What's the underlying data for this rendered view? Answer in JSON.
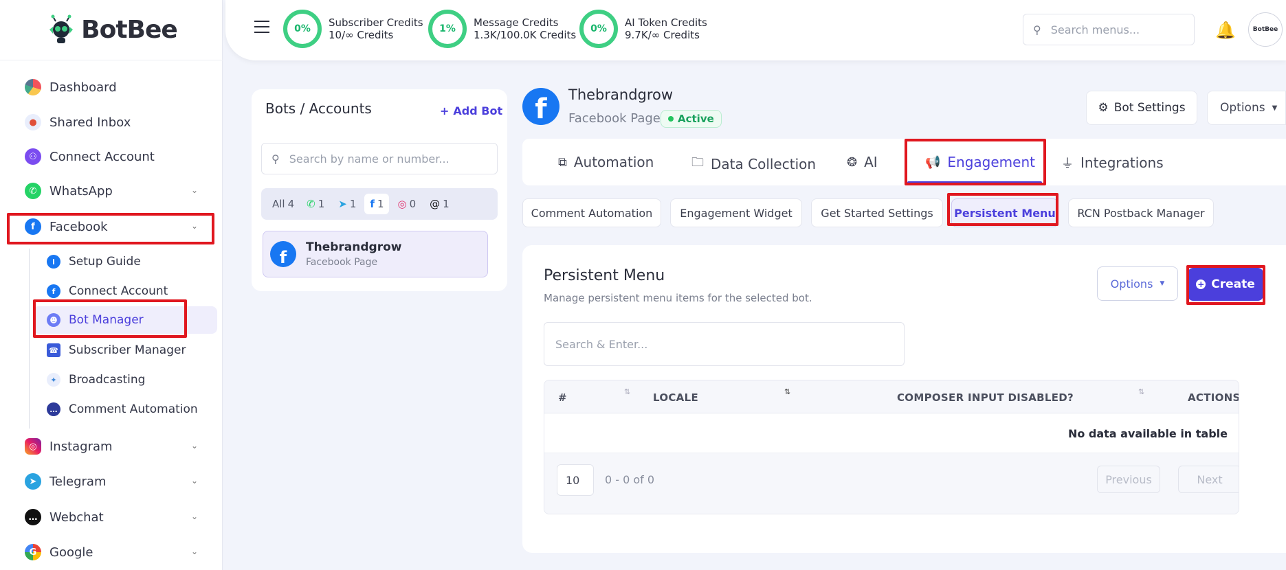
{
  "brand": {
    "name": "BotBee"
  },
  "sidebar": {
    "items": [
      {
        "label": "Dashboard"
      },
      {
        "label": "Shared Inbox"
      },
      {
        "label": "Connect Account"
      },
      {
        "label": "WhatsApp"
      },
      {
        "label": "Facebook"
      },
      {
        "label": "Instagram"
      },
      {
        "label": "Telegram"
      },
      {
        "label": "Webchat"
      },
      {
        "label": "Google"
      }
    ],
    "facebook_sub": [
      {
        "label": "Setup Guide"
      },
      {
        "label": "Connect Account"
      },
      {
        "label": "Bot Manager"
      },
      {
        "label": "Subscriber Manager"
      },
      {
        "label": "Broadcasting"
      },
      {
        "label": "Comment Automation"
      }
    ]
  },
  "topbar": {
    "credits": [
      {
        "percent": "0%",
        "title": "Subscriber Credits",
        "value": "10/∞ Credits"
      },
      {
        "percent": "1%",
        "title": "Message Credits",
        "value": "1.3K/100.0K Credits"
      },
      {
        "percent": "0%",
        "title": "AI Token Credits",
        "value": "9.7K/∞ Credits"
      }
    ],
    "search_placeholder": "Search menus...",
    "avatar_text": "BotBee"
  },
  "bots_panel": {
    "title": "Bots / Accounts",
    "add_label": "Add Bot",
    "search_placeholder": "Search by name or number...",
    "filters": [
      {
        "label": "All",
        "count": "4"
      },
      {
        "label": "whatsapp",
        "count": "1"
      },
      {
        "label": "telegram",
        "count": "1"
      },
      {
        "label": "facebook",
        "count": "1"
      },
      {
        "label": "instagram",
        "count": "0"
      },
      {
        "label": "threads",
        "count": "1"
      }
    ],
    "bot": {
      "name": "Thebrandgrow",
      "type": "Facebook Page"
    }
  },
  "bot_header": {
    "name": "Thebrandgrow",
    "type": "Facebook Page",
    "status": "Active",
    "settings_label": "Bot Settings",
    "options_label": "Options"
  },
  "main_tabs": [
    {
      "label": "Automation"
    },
    {
      "label": "Data Collection"
    },
    {
      "label": "AI"
    },
    {
      "label": "Engagement"
    },
    {
      "label": "Integrations"
    }
  ],
  "sub_tabs": [
    {
      "label": "Comment Automation"
    },
    {
      "label": "Engagement Widget"
    },
    {
      "label": "Get Started Settings"
    },
    {
      "label": "Persistent Menu"
    },
    {
      "label": "RCN Postback Manager"
    }
  ],
  "panel": {
    "title": "Persistent Menu",
    "subtitle": "Manage persistent menu items for the selected bot.",
    "options_label": "Options",
    "create_label": "Create",
    "search_placeholder": "Search & Enter...",
    "columns": [
      "#",
      "LOCALE",
      "COMPOSER INPUT DISABLED?",
      "ACTIONS"
    ],
    "empty_text": "No data available in table",
    "page_size": "10",
    "range_text": "0 - 0 of 0",
    "prev_label": "Previous",
    "next_label": "Next"
  },
  "colors": {
    "accent": "#4b3fdc",
    "green": "#3ecf83",
    "facebook": "#1877f2",
    "highlight": "#e0171f"
  }
}
